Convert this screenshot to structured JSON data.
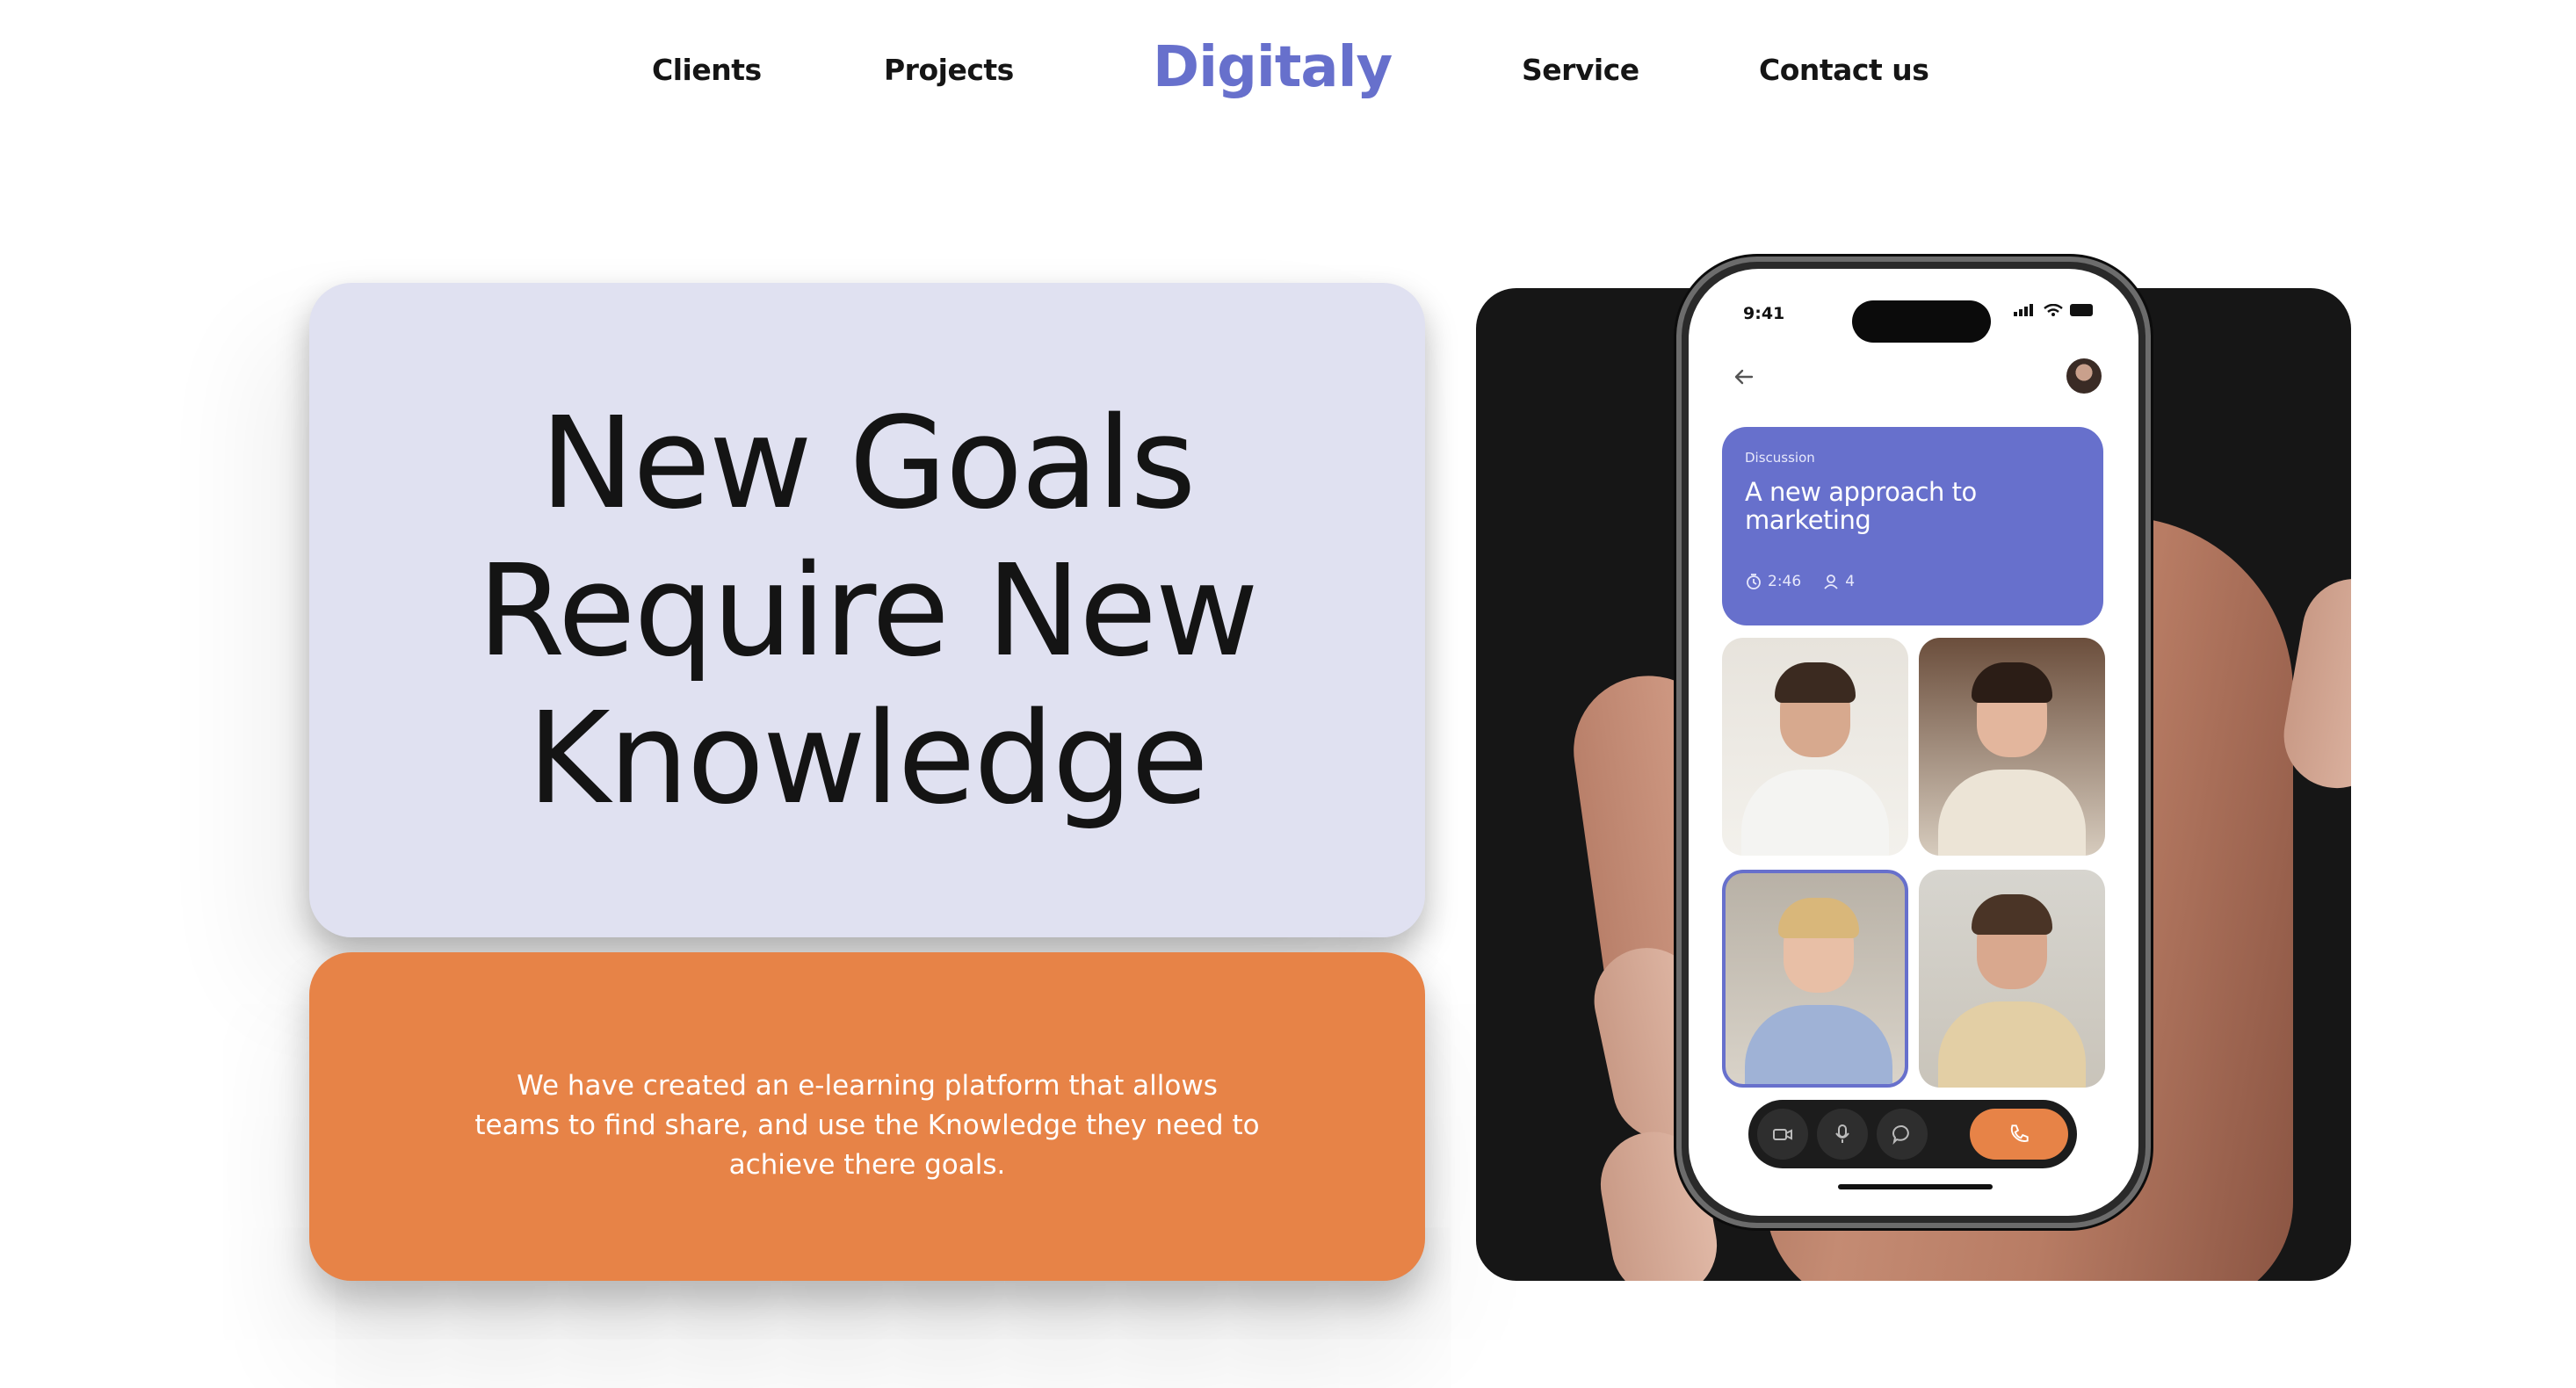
{
  "nav": {
    "clients": "Clients",
    "projects": "Projects",
    "logo": "Digitaly",
    "service": "Service",
    "contact": "Contact us"
  },
  "hero": {
    "headline": "New Goals Require New Knowledge",
    "description": "We have created an e-learning platform that allows teams to find share, and use the Knowledge they need to achieve there goals."
  },
  "phone": {
    "status_time": "9:41",
    "discussion_label": "Discussion",
    "discussion_title": "A new approach to marketing",
    "duration": "2:46",
    "participants": "4"
  },
  "colors": {
    "brand": "#6770cc",
    "accent": "#e78347",
    "card_bg": "#e0e1f1",
    "panel_dark": "#161616"
  },
  "icons": [
    "back-arrow-icon",
    "clock-icon",
    "user-icon",
    "camera-icon",
    "microphone-icon",
    "chat-icon",
    "phone-icon"
  ]
}
